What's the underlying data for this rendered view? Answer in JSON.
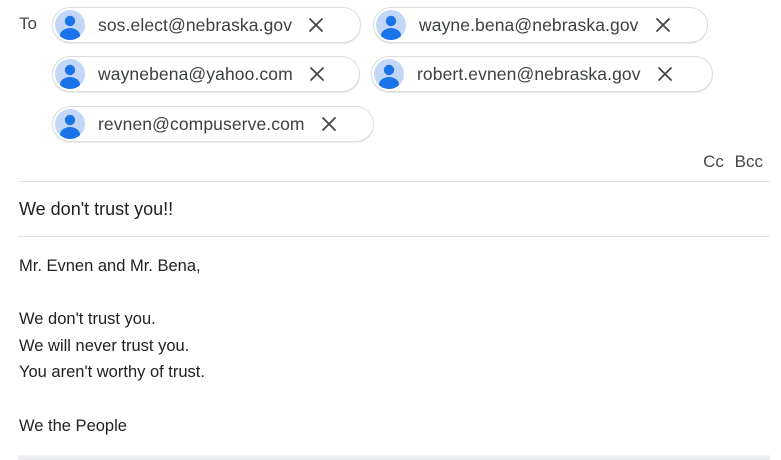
{
  "recipients": {
    "to_label": "To",
    "chips": [
      {
        "email": "sos.elect@nebraska.gov",
        "avatar_icon": "person-avatar-icon",
        "remove_icon": "close-icon"
      },
      {
        "email": "wayne.bena@nebraska.gov",
        "avatar_icon": "person-avatar-icon",
        "remove_icon": "close-icon"
      },
      {
        "email": "waynebena@yahoo.com",
        "avatar_icon": "person-avatar-icon",
        "remove_icon": "close-icon"
      },
      {
        "email": "robert.evnen@nebraska.gov",
        "avatar_icon": "person-avatar-icon",
        "remove_icon": "close-icon"
      },
      {
        "email": "revnen@compuserve.com",
        "avatar_icon": "person-avatar-icon",
        "remove_icon": "close-icon"
      }
    ],
    "cc_label": "Cc",
    "bcc_label": "Bcc"
  },
  "subject": "We don't trust you!!",
  "message": {
    "lines": [
      "Mr. Evnen and Mr. Bena,",
      "",
      "We don't trust you.",
      "We will never trust you.",
      "You aren't worthy of trust.",
      "",
      "We the People"
    ]
  },
  "colors": {
    "avatar_bg": "#c2d7f8",
    "avatar_fg": "#1a73e8",
    "chip_border": "#dadce0",
    "divider": "#e3e3e3"
  }
}
